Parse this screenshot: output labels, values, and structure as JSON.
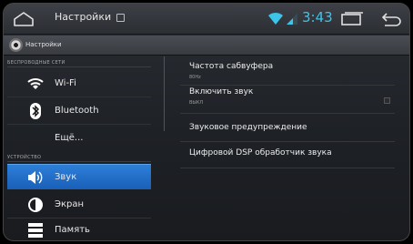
{
  "status_bar": {
    "app_title": "Настройки",
    "time": "3:43",
    "clock_color": "#3cc4ea",
    "icons": [
      "home-icon",
      "sd-card-icon",
      "wifi-icon",
      "signal-icon",
      "recents-icon",
      "back-icon"
    ]
  },
  "action_bar": {
    "title": "Настройки",
    "icon": "settings-app-icon"
  },
  "left_pane": {
    "sections": [
      {
        "header": "БЕСПРОВОДНЫЕ СЕТИ"
      },
      {
        "header": "УСТРОЙСТВО"
      }
    ],
    "items": [
      {
        "label": "Wi-Fi",
        "icon": "wifi-icon",
        "selected": false
      },
      {
        "label": "Bluetooth",
        "icon": "bluetooth-icon",
        "selected": false
      },
      {
        "label": "Ещё...",
        "icon": "",
        "selected": false
      },
      {
        "label": "Звук",
        "icon": "sound-icon",
        "selected": true
      },
      {
        "label": "Экран",
        "icon": "brightness-icon",
        "selected": false
      },
      {
        "label": "Память",
        "icon": "storage-icon",
        "selected": false
      }
    ],
    "selected_color": "#2070c8"
  },
  "right_pane": {
    "prefs": [
      {
        "title": "Частота сабвуфера",
        "summary": "80Hz"
      },
      {
        "title": "Включить звук",
        "summary": "ВЫКЛ",
        "checkbox": false
      },
      {
        "title": "Звуковое предупреждение",
        "summary": ""
      },
      {
        "title": "Цифровой DSP обработчик звука",
        "summary": ""
      }
    ]
  }
}
